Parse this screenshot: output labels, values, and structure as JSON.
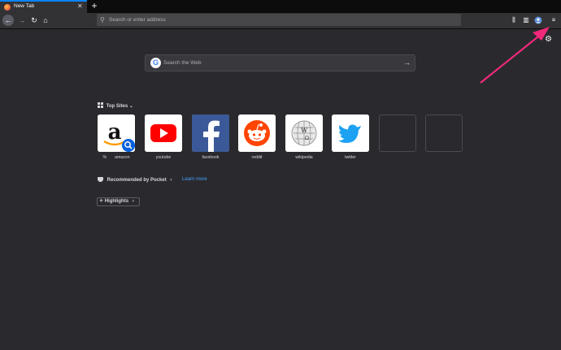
{
  "tab": {
    "title": "New Tab",
    "close": "✕"
  },
  "new_tab_button": "+",
  "nav": {
    "back": "←",
    "forward": "→",
    "reload": "↻",
    "home": "⌂"
  },
  "urlbar": {
    "icon": "⚲",
    "placeholder": "Search or enter address"
  },
  "toolbar": {
    "library": "⫼",
    "sidebar": "▥",
    "account": "●",
    "menu": "≡"
  },
  "settings": "⚙",
  "search": {
    "placeholder": "Search the Web",
    "engine_icon": "G",
    "go": "→"
  },
  "top_sites": {
    "header": "Top Sites",
    "chevron": "⌄",
    "sites": [
      {
        "label": "amazon",
        "prefix": "%"
      },
      {
        "label": "youtube"
      },
      {
        "label": "facebook"
      },
      {
        "label": "reddit"
      },
      {
        "label": "wikipedia"
      },
      {
        "label": "twitter"
      }
    ]
  },
  "pocket": {
    "header": "Recommended by Pocket",
    "chevron": "›",
    "learn_more": "Learn more"
  },
  "highlights": {
    "label": "Highlights",
    "chevron": "›"
  },
  "colors": {
    "accent": "#0a84ff",
    "annotation_arrow": "#f0287a",
    "background": "#2a2a2e"
  }
}
